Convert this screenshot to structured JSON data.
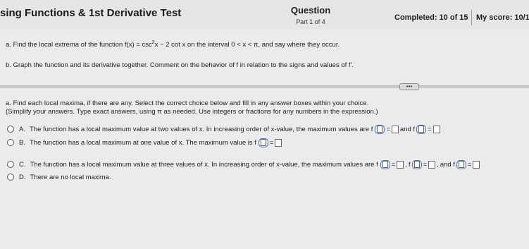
{
  "header": {
    "title": "sing Functions & 1st Derivative Test",
    "question_label": "Question",
    "part_label": "Part 1 of 4",
    "completed": "Completed: 10 of 15",
    "score": "My score: 10/1"
  },
  "prompt": {
    "a": {
      "prefix": "a. Find the local extrema of the function f(x) = csc",
      "sup": "2",
      "suffix": "x − 2 cot x on the interval 0 < x < π, and say where they occur."
    },
    "b": "b. Graph the function and its derivative together. Comment on the behavior of f in relation to the signs and values of f′.",
    "more_button": "•••"
  },
  "instructions": {
    "line1": "a. Find each local maxima, if there are any. Select the correct choice below and fill in any answer boxes within your choice.",
    "line2": "(Simplify your answers. Type exact answers, using π as needed. Use integers or fractions for any numbers in the expression.)"
  },
  "choices": {
    "A": {
      "letter": "A.",
      "text": "The function has a local maximum value at two values of x. In increasing order of x-value, the maximum values are f",
      "and": "and f"
    },
    "B": {
      "letter": "B.",
      "text": "The function has a local maximum at one value of x. The maximum value is f"
    },
    "C": {
      "letter": "C.",
      "text": "The function has a local maximum value at three values of x. In increasing order of x-value, the maximum values are f",
      "f": "f",
      "and": "and f"
    },
    "D": {
      "letter": "D.",
      "text": "There are no local maxima."
    }
  },
  "symbols": {
    "eq": "=",
    "comma": ","
  }
}
